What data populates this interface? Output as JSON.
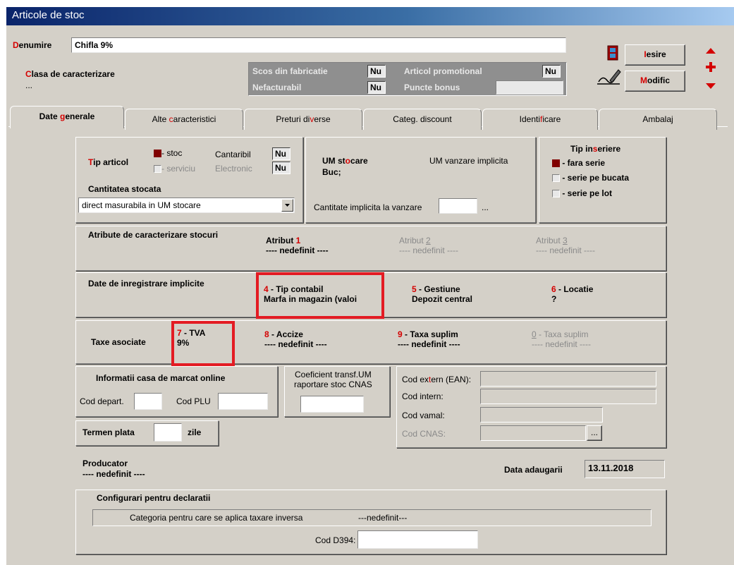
{
  "window": {
    "title": "Articole de stoc"
  },
  "header": {
    "denumire_label_first": "D",
    "denumire_label_rest": "enumire",
    "denumire_value": "Chifla 9%",
    "clasa_label_first": "C",
    "clasa_label_rest": "lasa de caracterizare",
    "clasa_value": "...",
    "flags": {
      "scos": "Scos din fabricatie",
      "scos_val": "Nu",
      "nefacturabil": "Nefacturabil",
      "nefacturabil_val": "Nu",
      "promo": "Articol promotional",
      "promo_val": "Nu",
      "bonus": "Puncte bonus"
    },
    "iesire_first": "I",
    "iesire_rest": "esire",
    "modific_first": "M",
    "modific_rest": "odific"
  },
  "tabs": {
    "t1a": "Date ",
    "t1b": "g",
    "t1c": "enerale",
    "t2a": "Alte ",
    "t2b": "c",
    "t2c": "aracteristici",
    "t3a": "Preturi di",
    "t3b": "v",
    "t3c": "erse",
    "t4": "Categ. discount",
    "t5a": "Identi",
    "t5b": "f",
    "t5c": "icare",
    "t6": "Ambalaj"
  },
  "tip_articol": {
    "label_first": "T",
    "label_rest": "ip articol",
    "stoc": "- stoc",
    "serviciu": "- serviciu",
    "cantaribil": "Cantaribil",
    "cantaribil_val": "Nu",
    "electronic": "Electronic",
    "electronic_val": "Nu",
    "cantitatea_label": "Cantitatea stocata",
    "cantitatea_value": "direct masurabila in UM stocare"
  },
  "um": {
    "stocare_a": "UM st",
    "stocare_b": "o",
    "stocare_c": "care",
    "stocare_value": "Buc;",
    "vanzare_label": "UM vanzare implicita",
    "cant_impl_label": "Cantitate implicita la vanzare",
    "dots": "..."
  },
  "tip_inseriere": {
    "title_a": "Tip in",
    "title_b": "s",
    "title_c": "eriere",
    "opt1": "- fara serie",
    "opt2": "- serie pe bucata",
    "opt3": "- serie pe lot"
  },
  "atribute": {
    "label": "Atribute de caracterizare stocuri",
    "a1_label": "Atribut ",
    "a1_num": "1",
    "a1_val": "---- nedefinit ----",
    "a2_label": "Atribut ",
    "a2_num": "2",
    "a2_val": "---- nedefinit ----",
    "a3_label": "Atribut ",
    "a3_num": "3",
    "a3_val": "---- nedefinit ----"
  },
  "date_inreg": {
    "label": "Date de inregistrare implicite",
    "c4_num": "4",
    "c4_label": " - Tip contabil",
    "c4_val": "Marfa in magazin (valoi",
    "c5_num": "5",
    "c5_label": " - Gestiune",
    "c5_val": "Depozit central",
    "c6_num": "6",
    "c6_label": " - Locatie",
    "c6_val": "?"
  },
  "taxe": {
    "label": "Taxe asociate",
    "t7_num": "7",
    "t7_label": " - TVA",
    "t7_val": "9%",
    "t8_num": "8",
    "t8_label": " - Accize",
    "t8_val": "---- nedefinit ----",
    "t9_num": "9",
    "t9_label": " - Taxa suplim",
    "t9_val": "---- nedefinit ----",
    "t0_num": "0",
    "t0_label": " - Taxa suplim",
    "t0_val": "---- nedefinit ----"
  },
  "casa": {
    "title": "Informatii casa de marcat online",
    "cod_depart": "Cod depart.",
    "cod_plu": "Cod PLU"
  },
  "coef": {
    "line1": "Coeficient transf.UM",
    "line2": "raportare stoc CNAS"
  },
  "coduri": {
    "ean_a": "Cod ex",
    "ean_b": "t",
    "ean_c": "ern (EAN):",
    "intern": "Cod intern:",
    "vamal": "Cod vamal:",
    "cnas": "Cod CNAS:",
    "dots": "..."
  },
  "termen": {
    "label": "Termen plata",
    "unit": "zile"
  },
  "producator": {
    "label": "Producator",
    "value": "---- nedefinit ----"
  },
  "data_adaugarii": {
    "label": "Data adaugarii",
    "value": "13.11.2018"
  },
  "declaratii": {
    "title": "Configurari pentru declaratii",
    "categoria_label": "Categoria pentru care se aplica taxare inversa",
    "categoria_value": "---nedefinit---",
    "cod_d394": "Cod D394:"
  },
  "colors": {
    "title_bar": "#0a246a",
    "accent_red": "#d40000",
    "face": "#d4d0c8",
    "highlight_box": "#e31b23"
  }
}
